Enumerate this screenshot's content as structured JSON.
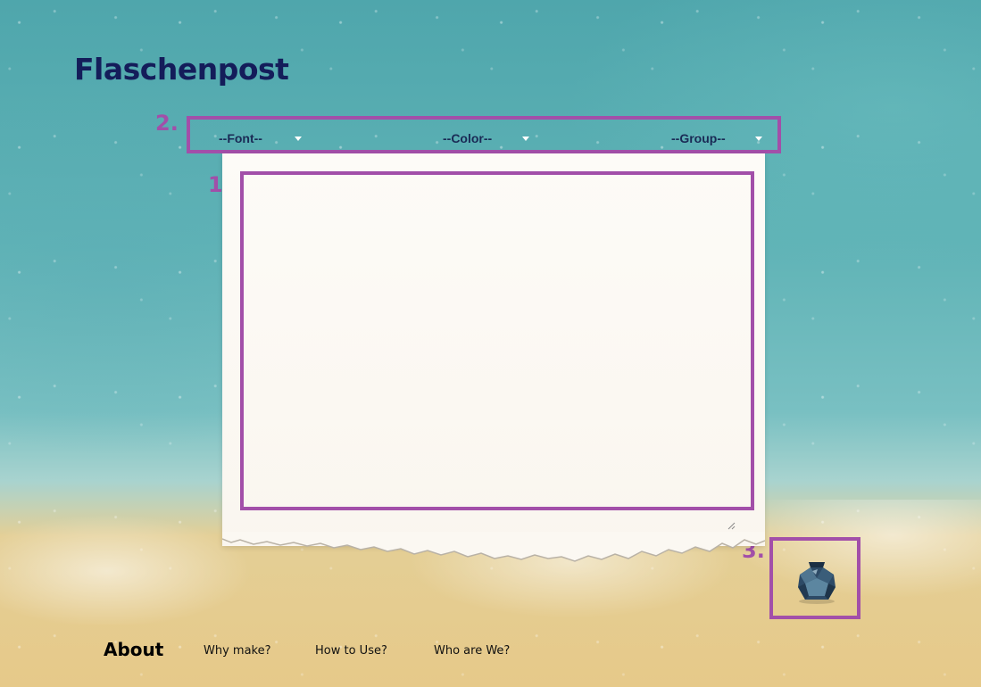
{
  "header": {
    "title": "Flaschenpost"
  },
  "markers": {
    "editor": "1.",
    "toolbar": "2.",
    "send": "3."
  },
  "toolbar": {
    "font_select": "--Font--",
    "color_select": "--Color--",
    "group_select": "--Group--"
  },
  "editor": {
    "value": "",
    "placeholder": ""
  },
  "send": {
    "icon": "bottle-icon"
  },
  "footer": {
    "about": "About",
    "links": [
      "Why make?",
      "How to Use?",
      "Who are We?"
    ]
  },
  "colors": {
    "accent": "#a24fa9",
    "title": "#141d5a",
    "sea": "#5fb3b6",
    "sand": "#e6c989",
    "paper": "#fdfbf7"
  }
}
